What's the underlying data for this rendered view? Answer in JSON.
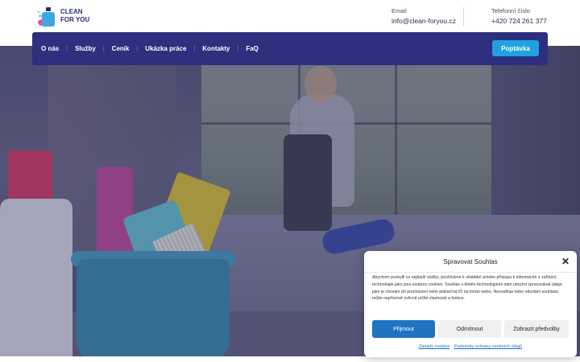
{
  "header": {
    "logo_line1": "CLEAN",
    "logo_line2": "FOR YOU",
    "email_label": "Email",
    "email_value": "info@clean-foryou.cz",
    "phone_label": "Telefonní číslo",
    "phone_value": "+420 724 261 377"
  },
  "nav": {
    "items": [
      "O nás",
      "Služby",
      "Ceník",
      "Ukázka práce",
      "Kontakty",
      "FaQ"
    ],
    "cta": "Poptávka"
  },
  "cookie": {
    "title": "Spravovat Souhlas",
    "text": "Abychom poskytli co nejlepší služby, používáme k ukládání a/nebo přístupu k informacím o zařízení, technologie jako jsou soubory cookies. Souhlas s těmito technologiemi nám umožní zpracovávat údaje, jako je chování při procházení nebo jedinečná ID na tomto webu. Nesouhlas nebo odvolání souhlasu může nepříznivě ovlivnit určité vlastnosti a funkce.",
    "accept": "Přijmout",
    "deny": "Odmítnout",
    "prefs": "Zobrazit předvolby",
    "link_cookies": "Zásady cookies",
    "link_privacy": "Podmínky ochrany osobních údajů"
  },
  "colors": {
    "nav_bg": "#2e2f7e",
    "cta": "#1fa3e0",
    "accept": "#1f73c0",
    "brand_text": "#2a2f7c"
  },
  "icons": [
    "logo-bottle-icon",
    "close-icon"
  ]
}
